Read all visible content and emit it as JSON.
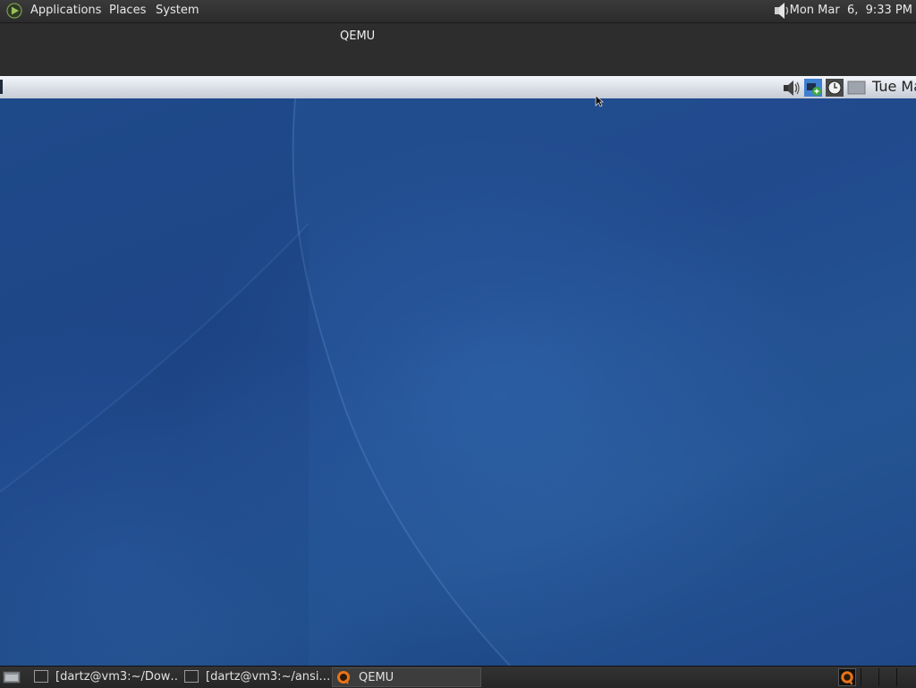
{
  "top_panel": {
    "menus": [
      "Applications",
      "Places",
      "System"
    ],
    "clock": "Mon Mar  6,  9:33 PM"
  },
  "qemu_window": {
    "title": "QEMU"
  },
  "guest_panel": {
    "clock": "Tue Ma"
  },
  "taskbar": {
    "tasks": [
      {
        "label": "[dartz@vm3:~/Dow…",
        "icon": "terminal-icon"
      },
      {
        "label": "[dartz@vm3:~/ansi…",
        "icon": "terminal-icon"
      },
      {
        "label": "QEMU",
        "icon": "qemu-icon",
        "active": true
      }
    ]
  },
  "colors": {
    "desktop": "#1d4587",
    "top_panel": "#2b2b2b",
    "guest_panel": "#d9dee6"
  }
}
